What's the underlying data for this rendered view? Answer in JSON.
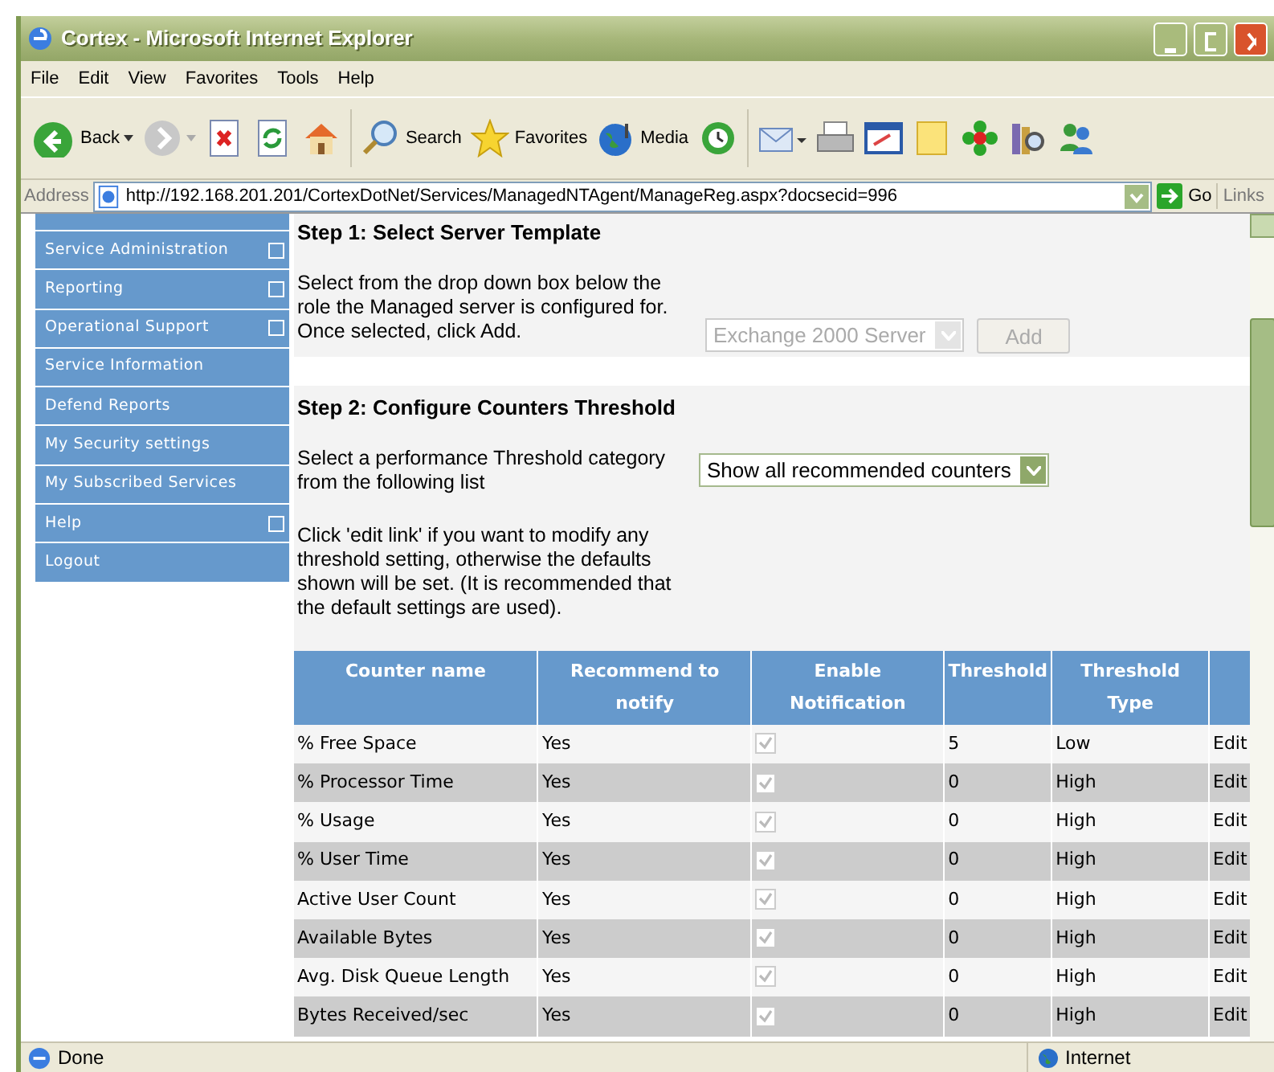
{
  "window": {
    "title": "Cortex - Microsoft Internet Explorer"
  },
  "menu": [
    "File",
    "Edit",
    "View",
    "Favorites",
    "Tools",
    "Help"
  ],
  "toolbar": [
    {
      "kind": "back",
      "label": "Back"
    },
    {
      "kind": "forward"
    },
    {
      "kind": "stop"
    },
    {
      "kind": "refresh"
    },
    {
      "kind": "home"
    },
    {
      "kind": "search",
      "label": "Search"
    },
    {
      "kind": "favorites",
      "label": "Favorites"
    },
    {
      "kind": "media",
      "label": "Media"
    },
    {
      "kind": "history"
    },
    {
      "kind": "mail"
    },
    {
      "kind": "print"
    },
    {
      "kind": "edit"
    },
    {
      "kind": "note"
    },
    {
      "kind": "flower"
    },
    {
      "kind": "research"
    },
    {
      "kind": "messenger"
    }
  ],
  "address": {
    "label": "Address",
    "url": "http://192.168.201.201/CortexDotNet/Services/ManagedNTAgent/ManageReg.aspx?docsecid=996",
    "go": "Go",
    "links": "Links"
  },
  "sidebar": {
    "items": [
      {
        "label": "Service Administration",
        "expandable": true
      },
      {
        "label": "Reporting",
        "expandable": true
      },
      {
        "label": "Operational Support",
        "expandable": true
      },
      {
        "label": "Service Information",
        "expandable": false
      },
      {
        "label": "Defend Reports",
        "expandable": false
      },
      {
        "label": "My Security settings",
        "expandable": false
      },
      {
        "label": "My Subscribed Services",
        "expandable": false
      },
      {
        "label": "Help",
        "expandable": true
      },
      {
        "label": "Logout",
        "expandable": false
      }
    ]
  },
  "step1": {
    "heading": "Step 1: Select Server Template",
    "text": "Select from the drop down box below the role the Managed server is configured for. Once selected, click Add.",
    "select": {
      "value": "Exchange 2000 Server",
      "disabled": true
    },
    "button": {
      "label": "Add",
      "disabled": true
    }
  },
  "step2": {
    "heading": "Step 2: Configure Counters Threshold",
    "text": "Select a performance Threshold category from the following list",
    "select": {
      "value": "Show all recommended counters",
      "disabled": false
    },
    "note": "Click 'edit link' if you want to modify any threshold setting, otherwise the defaults shown will be set. (It is recommended that the default settings are used)."
  },
  "table": {
    "columns": [
      "Counter name",
      "Recommend to notify",
      "Enable Notification",
      "Threshold",
      "Threshold Type"
    ],
    "rows": [
      {
        "name": "% Free Space",
        "recommend": "Yes",
        "checked": true,
        "threshold": "5",
        "type": "Low",
        "action": "Edit"
      },
      {
        "name": "% Processor Time",
        "recommend": "Yes",
        "checked": true,
        "threshold": "0",
        "type": "High",
        "action": "Edit"
      },
      {
        "name": "% Usage",
        "recommend": "Yes",
        "checked": true,
        "threshold": "0",
        "type": "High",
        "action": "Edit"
      },
      {
        "name": "% User Time",
        "recommend": "Yes",
        "checked": true,
        "threshold": "0",
        "type": "High",
        "action": "Edit"
      },
      {
        "name": "Active User Count",
        "recommend": "Yes",
        "checked": true,
        "threshold": "0",
        "type": "High",
        "action": "Edit"
      },
      {
        "name": "Available Bytes",
        "recommend": "Yes",
        "checked": true,
        "threshold": "0",
        "type": "High",
        "action": "Edit"
      },
      {
        "name": "Avg. Disk Queue Length",
        "recommend": "Yes",
        "checked": true,
        "threshold": "0",
        "type": "High",
        "action": "Edit"
      },
      {
        "name": "Bytes Received/sec",
        "recommend": "Yes",
        "checked": true,
        "threshold": "0",
        "type": "High",
        "action": "Edit"
      }
    ]
  },
  "status_bar": {
    "text": "Done",
    "zone": "Internet"
  }
}
